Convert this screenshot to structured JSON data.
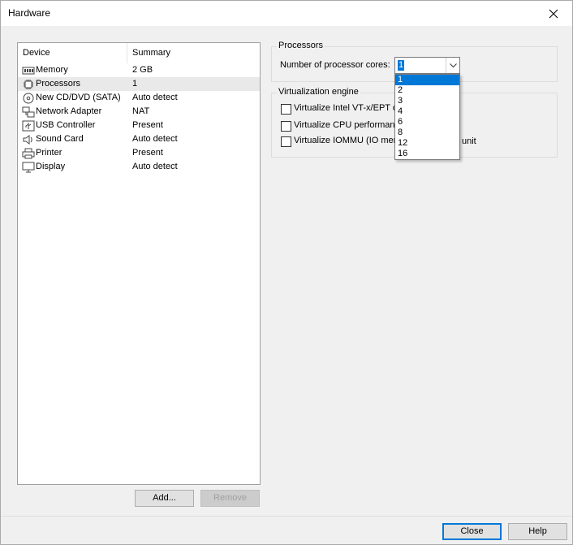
{
  "window": {
    "title": "Hardware"
  },
  "devices": {
    "header_device": "Device",
    "header_summary": "Summary",
    "items": [
      {
        "icon": "memory-icon",
        "name": "Memory",
        "summary": "2 GB"
      },
      {
        "icon": "processor-icon",
        "name": "Processors",
        "summary": "1"
      },
      {
        "icon": "cd-dvd-icon",
        "name": "New CD/DVD (SATA)",
        "summary": "Auto detect"
      },
      {
        "icon": "network-icon",
        "name": "Network Adapter",
        "summary": "NAT"
      },
      {
        "icon": "usb-icon",
        "name": "USB Controller",
        "summary": "Present"
      },
      {
        "icon": "speaker-icon",
        "name": "Sound Card",
        "summary": "Auto detect"
      },
      {
        "icon": "printer-icon",
        "name": "Printer",
        "summary": "Present"
      },
      {
        "icon": "display-icon",
        "name": "Display",
        "summary": "Auto detect"
      }
    ],
    "selected_index": 1
  },
  "buttons": {
    "add": "Add...",
    "remove": "Remove",
    "close": "Close",
    "help": "Help"
  },
  "processors": {
    "group_label": "Processors",
    "cores_label": "Number of processor cores:",
    "cores_value": "1",
    "options": [
      "1",
      "2",
      "3",
      "4",
      "6",
      "8",
      "12",
      "16"
    ]
  },
  "virtualization": {
    "group_label": "Virtualization engine",
    "options": [
      {
        "label": "Virtualize Intel VT-x/EPT o",
        "checked": false
      },
      {
        "label": "Virtualize CPU performan",
        "checked": false
      },
      {
        "label": "Virtualize IOMMU (IO mem",
        "checked": false
      }
    ],
    "tail_text": "unit"
  },
  "colors": {
    "accent": "#0078d7",
    "selected_row": "#e9e9e9"
  }
}
